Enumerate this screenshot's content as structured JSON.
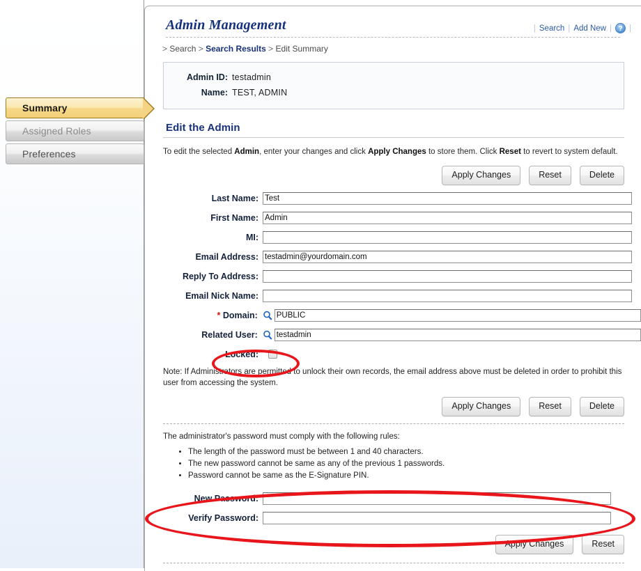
{
  "sidebar": {
    "tabs": [
      {
        "label": "Summary",
        "state": "active"
      },
      {
        "label": "Assigned Roles",
        "state": "inactive"
      },
      {
        "label": "Preferences",
        "state": "inactive"
      }
    ]
  },
  "header": {
    "title": "Admin Management",
    "links": [
      {
        "label": "Search"
      },
      {
        "label": "Add New"
      }
    ],
    "help_icon": "help-question-icon",
    "help_glyph": "?"
  },
  "breadcrumb": {
    "prefix": ">",
    "items": [
      {
        "label": "Search",
        "strong": false
      },
      {
        "label": "Search Results",
        "strong": true
      },
      {
        "label": "Edit Summary",
        "strong": false
      }
    ],
    "separator": ">"
  },
  "summary": {
    "admin_id_label": "Admin ID:",
    "admin_id_value": "testadmin",
    "name_label": "Name:",
    "name_value": "TEST, ADMIN"
  },
  "section": {
    "title": "Edit the Admin",
    "instruction_pre": "To edit the selected ",
    "instruction_b1": "Admin",
    "instruction_mid": ", enter your changes and click ",
    "instruction_b2": "Apply Changes",
    "instruction_mid2": " to store them. Click ",
    "instruction_b3": "Reset",
    "instruction_post": " to revert to system default."
  },
  "buttons": {
    "apply": "Apply Changes",
    "reset": "Reset",
    "delete": "Delete"
  },
  "form": {
    "fields": [
      {
        "label": "Last Name:",
        "value": "Test",
        "lookup": false,
        "required": false
      },
      {
        "label": "First Name:",
        "value": "Admin",
        "lookup": false,
        "required": false
      },
      {
        "label": "MI:",
        "value": "",
        "lookup": false,
        "required": false
      },
      {
        "label": "Email Address:",
        "value": "testadmin@yourdomain.com",
        "lookup": false,
        "required": false
      },
      {
        "label": "Reply To Address:",
        "value": "",
        "lookup": false,
        "required": false
      },
      {
        "label": "Email Nick Name:",
        "value": "",
        "lookup": false,
        "required": false
      },
      {
        "label": "Domain:",
        "value": "PUBLIC",
        "lookup": true,
        "required": true
      },
      {
        "label": "Related User:",
        "value": "testadmin",
        "lookup": true,
        "required": false
      }
    ],
    "locked_label": "Locked:",
    "locked_checked": false,
    "lookup_icon": "magnifier-icon"
  },
  "note": "Note: If Administrators are permitted to unlock their own records, the email address above must be deleted in order to prohibit this user from accessing the system.",
  "password": {
    "rules_intro": "The administrator's password must comply with the following rules:",
    "rules": [
      "The length of the password must be between 1 and 40 characters.",
      "The new password cannot be same as any of the previous 1 passwords.",
      "Password cannot be same as the E-Signature PIN."
    ],
    "new_label": "New Password:",
    "new_value": "",
    "verify_label": "Verify Password:",
    "verify_value": "",
    "apply": "Apply Changes",
    "reset": "Reset"
  },
  "annotations": {
    "locked_highlight": "red-ellipse-locked",
    "password_highlight": "red-ellipse-password",
    "color": "#e8151b"
  }
}
